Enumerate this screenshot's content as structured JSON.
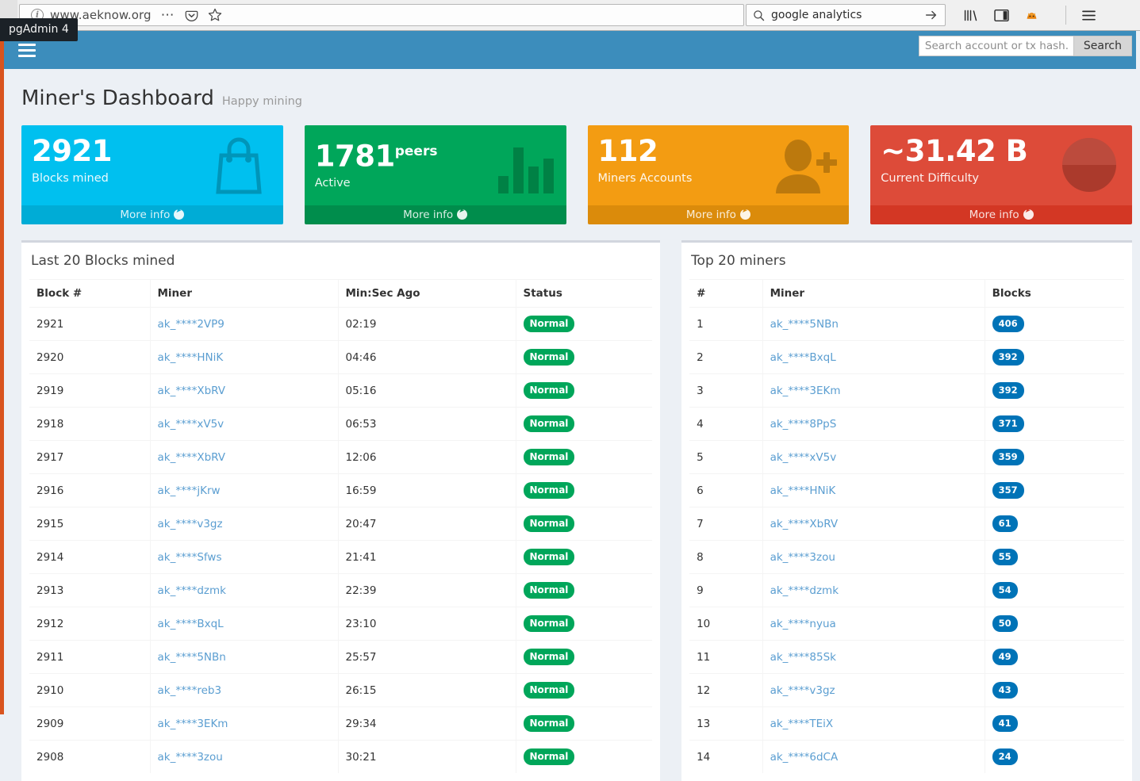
{
  "browser": {
    "url": "www.aeknow.org",
    "search_query": "google analytics",
    "icons": {
      "info": "info-icon",
      "dots": "page-actions-icon",
      "pocket": "pocket-icon",
      "bookmark": "star-icon",
      "search": "search-icon",
      "go": "arrow-right-icon",
      "library": "library-icon",
      "sidebar": "sidebar-icon",
      "extension": "fox-extension-icon",
      "menu": "hamburger-menu-icon"
    }
  },
  "tooltip": {
    "text": "pgAdmin 4"
  },
  "navbar": {
    "menu_icon": "hamburger-icon",
    "search_placeholder": "Search account or tx hash...",
    "search_value": "",
    "search_button": "Search"
  },
  "header": {
    "title": "Miner's Dashboard",
    "subtitle": "Happy mining"
  },
  "cards": [
    {
      "value": "2921",
      "sup": "",
      "label": "Blocks mined",
      "more": "More info",
      "color": "#00c0ef",
      "icon": "shopping-bag-icon"
    },
    {
      "value": "1781",
      "sup": "peers",
      "label": "Active",
      "more": "More info",
      "color": "#00a65a",
      "icon": "bar-chart-icon"
    },
    {
      "value": "112",
      "sup": "",
      "label": "Miners Accounts",
      "more": "More info",
      "color": "#f39c12",
      "icon": "user-plus-icon"
    },
    {
      "value": "~31.42 B",
      "sup": "",
      "label": "Current Difficulty",
      "more": "More info",
      "color": "#dd4b39",
      "icon": "pie-chart-icon"
    }
  ],
  "blocks_table": {
    "title": "Last 20 Blocks mined",
    "columns": [
      "Block #",
      "Miner",
      "Min:Sec Ago",
      "Status"
    ],
    "rows": [
      {
        "block": "2921",
        "miner": "ak_****2VP9",
        "ago": "02:19",
        "status": "Normal"
      },
      {
        "block": "2920",
        "miner": "ak_****HNiK",
        "ago": "04:46",
        "status": "Normal"
      },
      {
        "block": "2919",
        "miner": "ak_****XbRV",
        "ago": "05:16",
        "status": "Normal"
      },
      {
        "block": "2918",
        "miner": "ak_****xV5v",
        "ago": "06:53",
        "status": "Normal"
      },
      {
        "block": "2917",
        "miner": "ak_****XbRV",
        "ago": "12:06",
        "status": "Normal"
      },
      {
        "block": "2916",
        "miner": "ak_****jKrw",
        "ago": "16:59",
        "status": "Normal"
      },
      {
        "block": "2915",
        "miner": "ak_****v3gz",
        "ago": "20:47",
        "status": "Normal"
      },
      {
        "block": "2914",
        "miner": "ak_****Sfws",
        "ago": "21:41",
        "status": "Normal"
      },
      {
        "block": "2913",
        "miner": "ak_****dzmk",
        "ago": "22:39",
        "status": "Normal"
      },
      {
        "block": "2912",
        "miner": "ak_****BxqL",
        "ago": "23:10",
        "status": "Normal"
      },
      {
        "block": "2911",
        "miner": "ak_****5NBn",
        "ago": "25:57",
        "status": "Normal"
      },
      {
        "block": "2910",
        "miner": "ak_****reb3",
        "ago": "26:15",
        "status": "Normal"
      },
      {
        "block": "2909",
        "miner": "ak_****3EKm",
        "ago": "29:34",
        "status": "Normal"
      },
      {
        "block": "2908",
        "miner": "ak_****3zou",
        "ago": "30:21",
        "status": "Normal"
      }
    ]
  },
  "miners_table": {
    "title": "Top 20 miners",
    "columns": [
      "#",
      "Miner",
      "Blocks"
    ],
    "rows": [
      {
        "rank": "1",
        "miner": "ak_****5NBn",
        "blocks": "406"
      },
      {
        "rank": "2",
        "miner": "ak_****BxqL",
        "blocks": "392"
      },
      {
        "rank": "3",
        "miner": "ak_****3EKm",
        "blocks": "392"
      },
      {
        "rank": "4",
        "miner": "ak_****8PpS",
        "blocks": "371"
      },
      {
        "rank": "5",
        "miner": "ak_****xV5v",
        "blocks": "359"
      },
      {
        "rank": "6",
        "miner": "ak_****HNiK",
        "blocks": "357"
      },
      {
        "rank": "7",
        "miner": "ak_****XbRV",
        "blocks": "61"
      },
      {
        "rank": "8",
        "miner": "ak_****3zou",
        "blocks": "55"
      },
      {
        "rank": "9",
        "miner": "ak_****dzmk",
        "blocks": "54"
      },
      {
        "rank": "10",
        "miner": "ak_****nyua",
        "blocks": "50"
      },
      {
        "rank": "11",
        "miner": "ak_****85Sk",
        "blocks": "49"
      },
      {
        "rank": "12",
        "miner": "ak_****v3gz",
        "blocks": "43"
      },
      {
        "rank": "13",
        "miner": "ak_****TEiX",
        "blocks": "41"
      },
      {
        "rank": "14",
        "miner": "ak_****6dCA",
        "blocks": "24"
      }
    ]
  }
}
